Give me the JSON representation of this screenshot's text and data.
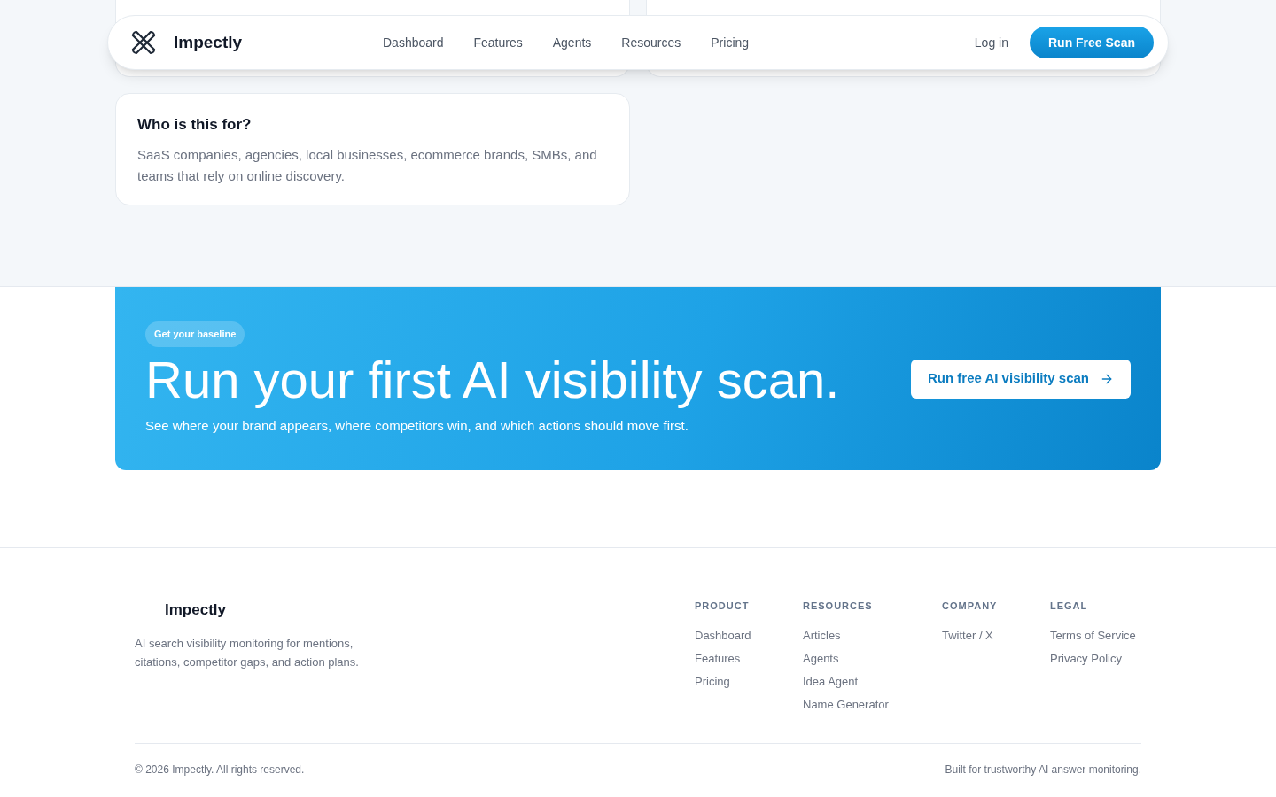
{
  "nav": {
    "brand": "Impectly",
    "links": [
      {
        "label": "Dashboard"
      },
      {
        "label": "Features"
      },
      {
        "label": "Agents"
      },
      {
        "label": "Resources"
      },
      {
        "label": "Pricing"
      }
    ],
    "login": "Log in",
    "cta": "Run Free Scan"
  },
  "top_cards": [
    {
      "kind": "card"
    },
    {
      "kind": "card"
    }
  ],
  "faq_card": {
    "title": "Who is this for?",
    "body": "SaaS companies, agencies, local businesses, ecommerce brands, SMBs, and teams that rely on online discovery."
  },
  "cta_banner": {
    "badge": "Get your baseline",
    "title": "Run your first AI visibility scan.",
    "subtitle": "See where your brand appears, where competitors win, and which actions should move first.",
    "button": "Run free AI visibility scan"
  },
  "footer": {
    "brand": "Impectly",
    "tagline": "AI search visibility monitoring for mentions, citations, competitor gaps, and action plans.",
    "columns": [
      {
        "heading": "PRODUCT",
        "links": [
          "Dashboard",
          "Features",
          "Pricing"
        ]
      },
      {
        "heading": "RESOURCES",
        "links": [
          "Articles",
          "Agents",
          "Idea Agent",
          "Name Generator"
        ]
      },
      {
        "heading": "COMPANY",
        "links": [
          "Twitter / X"
        ]
      },
      {
        "heading": "LEGAL",
        "links": [
          "Terms of Service",
          "Privacy Policy"
        ]
      }
    ],
    "copyright": "© 2026 Impectly. All rights reserved.",
    "note": "Built for trustworthy AI answer monitoring."
  }
}
